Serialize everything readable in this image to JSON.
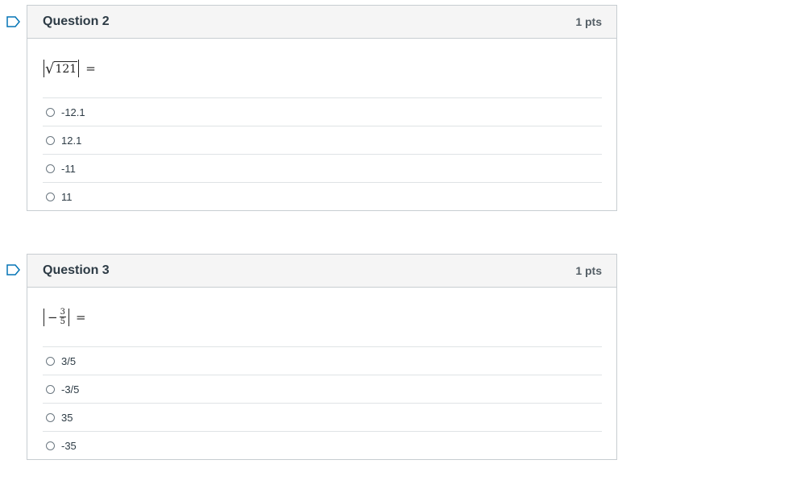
{
  "questions": [
    {
      "title": "Question 2",
      "points": "1 pts",
      "expression": {
        "type": "abs-sqrt",
        "radicand": "121",
        "equals": "="
      },
      "answers": [
        "-12.1",
        "12.1",
        "-11",
        "11"
      ]
    },
    {
      "title": "Question 3",
      "points": "1 pts",
      "expression": {
        "type": "abs-neg-fraction",
        "sign": "−",
        "numerator": "3",
        "denominator": "5",
        "equals": "="
      },
      "answers": [
        "3/5",
        "-3/5",
        "35",
        "-35"
      ]
    }
  ],
  "colors": {
    "flag": "#0374b5",
    "header_bg": "#f5f5f5",
    "border": "#c7cdd1"
  },
  "icons": {
    "flag": "bookmark-flag-icon",
    "radio": "radio-button-icon"
  }
}
